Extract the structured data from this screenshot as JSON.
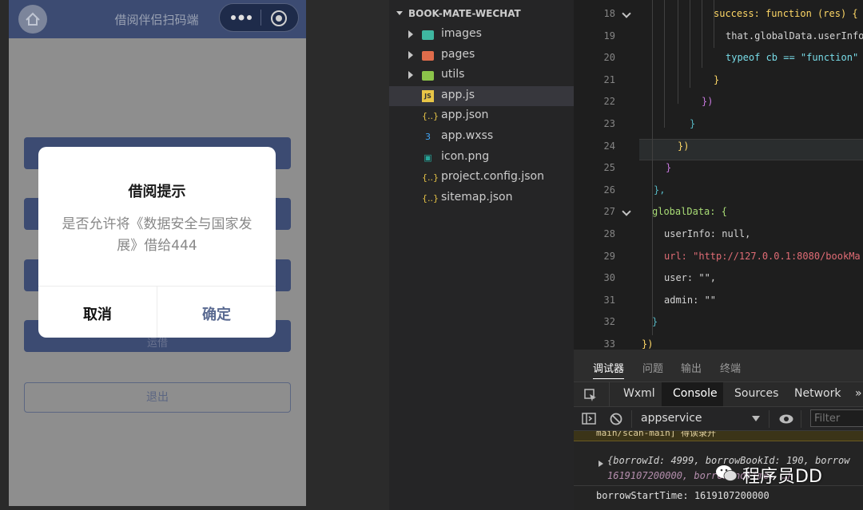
{
  "simulator": {
    "nav_title": "借阅伴侣扫码端",
    "logout_label": "退出",
    "fourth_button_partial": "运借",
    "dialog": {
      "title": "借阅提示",
      "body": "是否允许将《数据安全与国家发展》借给444",
      "cancel": "取消",
      "confirm": "确定"
    }
  },
  "explorer": {
    "project": "BOOK-MATE-WECHAT",
    "items": [
      {
        "label": "images",
        "type": "folder",
        "icon": "folder-images-icon",
        "color": "#3fb6a0"
      },
      {
        "label": "pages",
        "type": "folder",
        "icon": "folder-pages-icon",
        "color": "#e06c4b"
      },
      {
        "label": "utils",
        "type": "folder",
        "icon": "folder-utils-icon",
        "color": "#8bc34a"
      },
      {
        "label": "app.js",
        "type": "file",
        "icon": "js-file-icon",
        "glyph": "JS",
        "color": "#e8c547"
      },
      {
        "label": "app.json",
        "type": "file",
        "icon": "json-file-icon",
        "glyph": "{..}",
        "color": "#e8c547"
      },
      {
        "label": "app.wxss",
        "type": "file",
        "icon": "css-file-icon",
        "glyph": "3",
        "color": "#42a5f5"
      },
      {
        "label": "icon.png",
        "type": "file",
        "icon": "image-file-icon",
        "glyph": "▣",
        "color": "#26a69a"
      },
      {
        "label": "project.config.json",
        "type": "file",
        "icon": "json-file-icon",
        "glyph": "{..}",
        "color": "#e8c547"
      },
      {
        "label": "sitemap.json",
        "type": "file",
        "icon": "json-file-icon",
        "glyph": "{..}",
        "color": "#e8c547"
      }
    ]
  },
  "editor": {
    "lines": [
      {
        "n": "18",
        "text": "success: function (res) {",
        "fold": true
      },
      {
        "n": "19",
        "text": "that.globalData.userInfo"
      },
      {
        "n": "20",
        "text": "typeof cb == \"function\""
      },
      {
        "n": "21",
        "text": "}"
      },
      {
        "n": "22",
        "text": "})"
      },
      {
        "n": "23",
        "text": "}"
      },
      {
        "n": "24",
        "text": "})"
      },
      {
        "n": "25",
        "text": "}"
      },
      {
        "n": "26",
        "text": "},"
      },
      {
        "n": "27",
        "text": "globalData: {",
        "fold": true
      },
      {
        "n": "28",
        "text": "userInfo: null,"
      },
      {
        "n": "29",
        "text": "url: \"http://127.0.0.1:8080/bookMa"
      },
      {
        "n": "30",
        "text": "user: \"\","
      },
      {
        "n": "31",
        "text": "admin: \"\""
      },
      {
        "n": "32",
        "text": "}"
      },
      {
        "n": "33",
        "text": "})"
      }
    ]
  },
  "panel": {
    "tabs": [
      "调试器",
      "问题",
      "输出",
      "终端"
    ],
    "devtools_tabs": [
      "Wxml",
      "Console",
      "Sources",
      "Network",
      "»"
    ],
    "context": "appservice",
    "filter_placeholder": "Filter",
    "console": {
      "top_partial": "main/scan-main] 得读录开",
      "object_line1": "{borrowId: 4999, borrowBookId: 190, borrow",
      "object_line2": "1619107200000, borrowEndTime: …}",
      "time_line": "borrowStartTime: 1619107200000"
    }
  },
  "watermark": {
    "text": "程序员DD"
  }
}
